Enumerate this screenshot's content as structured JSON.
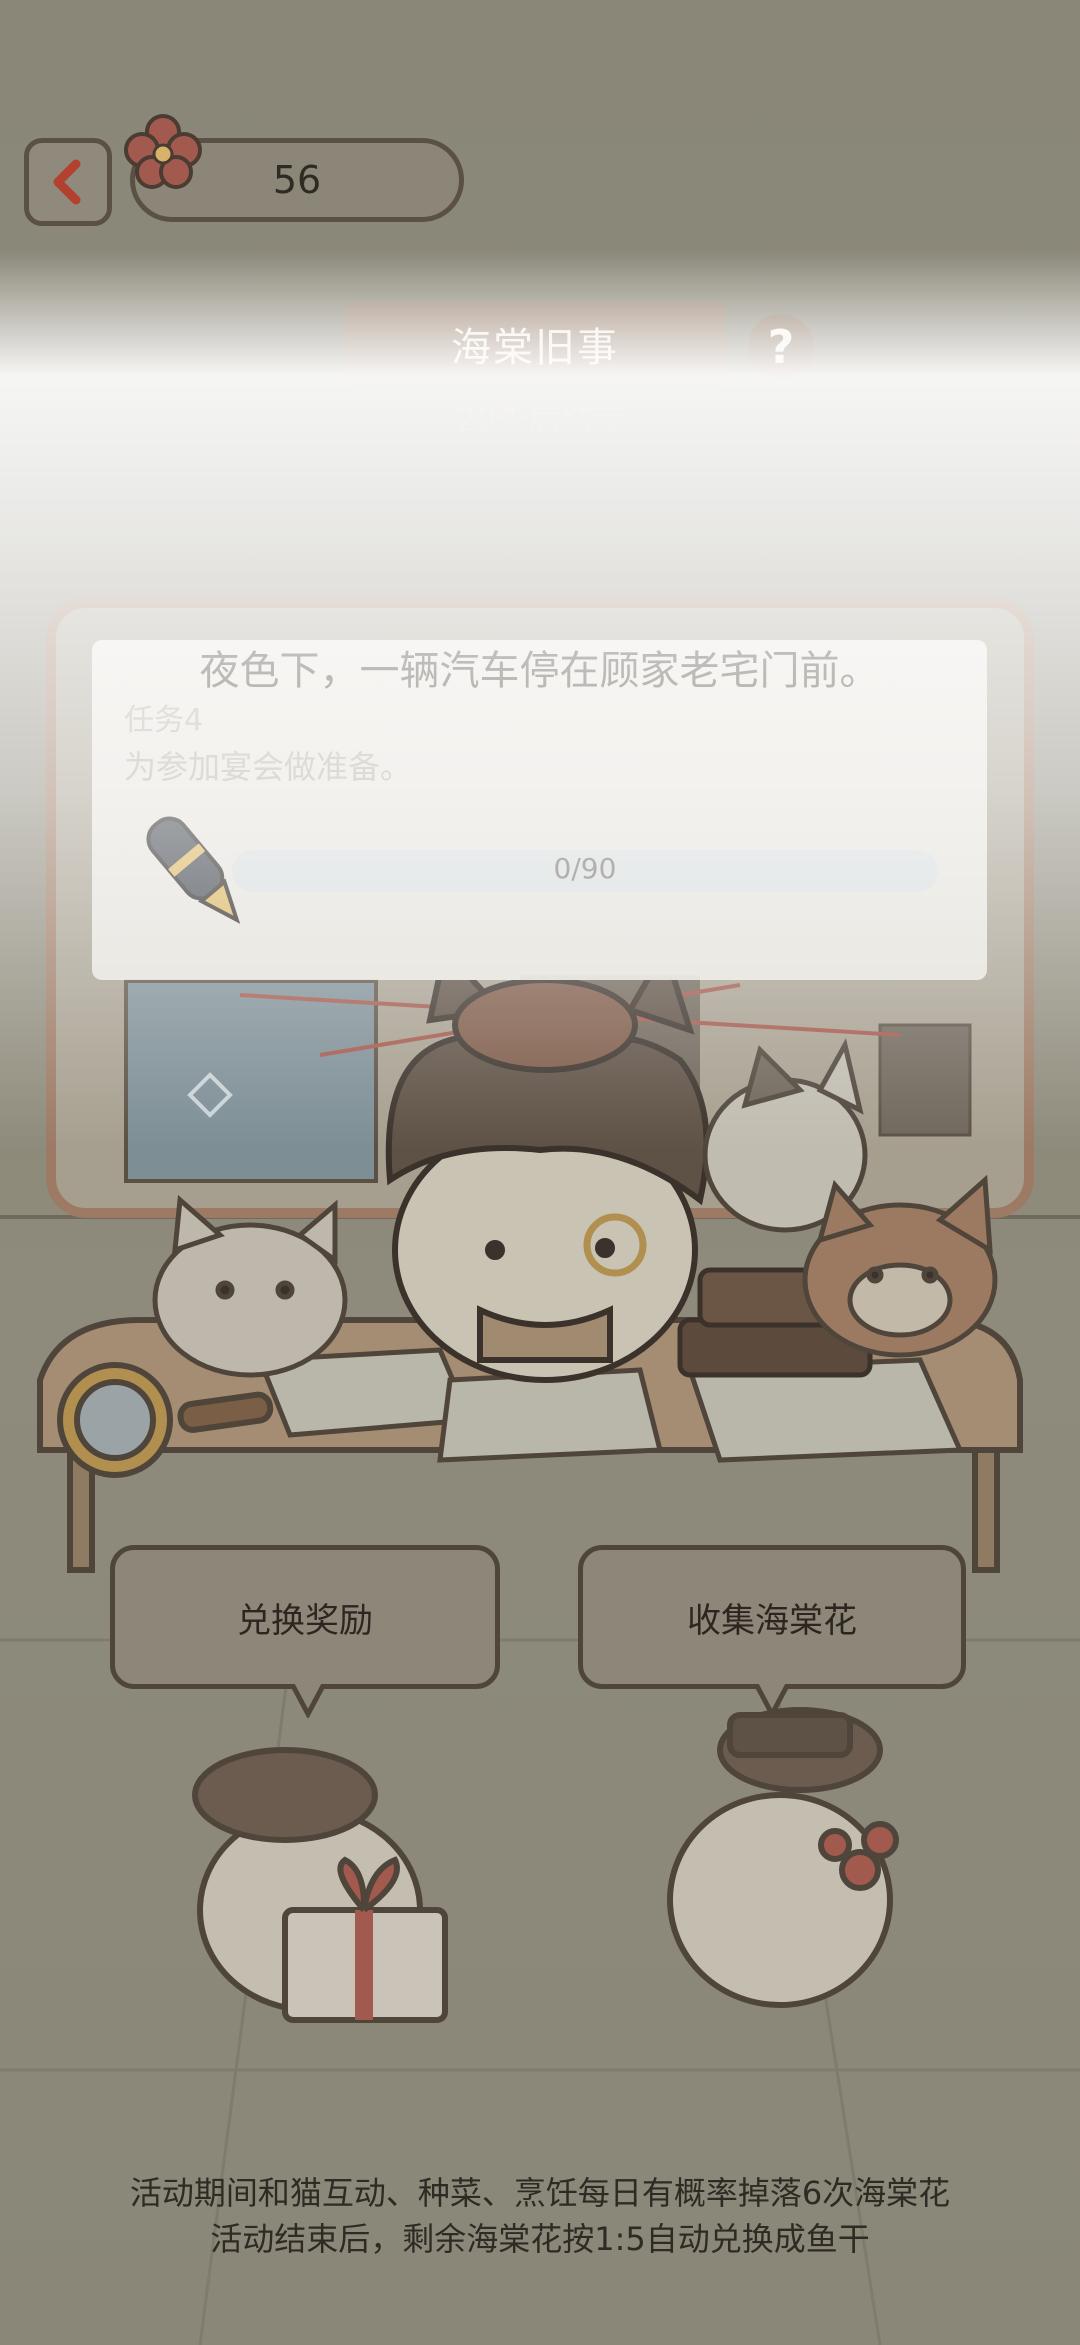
{
  "header": {
    "back_icon": "chevron-left-icon",
    "currency_icon": "begonia-flower-icon",
    "currency_value": "56"
  },
  "event": {
    "title": "海棠旧事",
    "ends_text": "20天后结束",
    "help_label": "?"
  },
  "story": {
    "narration": "夜色下，一辆汽车停在顾家老宅门前。",
    "task_number": "任务4",
    "task_description": "为参加宴会做准备。",
    "progress_text": "0/90",
    "progress_fraction": 0.0
  },
  "buttons": {
    "exchange_label": "兑换奖励",
    "collect_label": "收集海棠花"
  },
  "footer": {
    "line1": "活动期间和猫互动、种菜、烹饪每日有概率掉落6次海棠花",
    "line2": "活动结束后，剩余海棠花按1:5自动兑换成鱼干"
  },
  "colors": {
    "overlay": "#8a8778",
    "title_plate": "#9a8371",
    "outline": "#5b5044",
    "back_chevron": "#b3412f"
  }
}
